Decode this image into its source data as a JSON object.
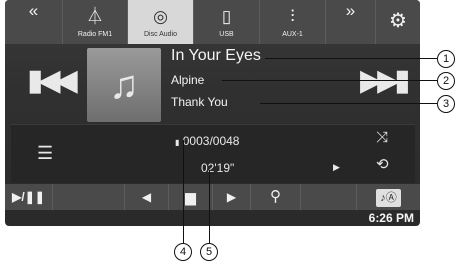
{
  "topbar": {
    "sources": [
      {
        "label": "Radio FM1",
        "icon": "antenna-icon"
      },
      {
        "label": "Disc Audio",
        "icon": "disc-icon"
      },
      {
        "label": "USB",
        "icon": "usb-icon"
      },
      {
        "label": "AUX-1",
        "icon": "aux-icon"
      }
    ],
    "active_source": "Disc Audio"
  },
  "now_playing": {
    "title": "In Your Eyes",
    "artist": "Alpine",
    "album": "Thank You"
  },
  "playback": {
    "track_counter": "0003/0048",
    "elapsed": "02'19\""
  },
  "clock": "6:26 PM",
  "callouts": [
    "1",
    "2",
    "3",
    "4",
    "5"
  ]
}
